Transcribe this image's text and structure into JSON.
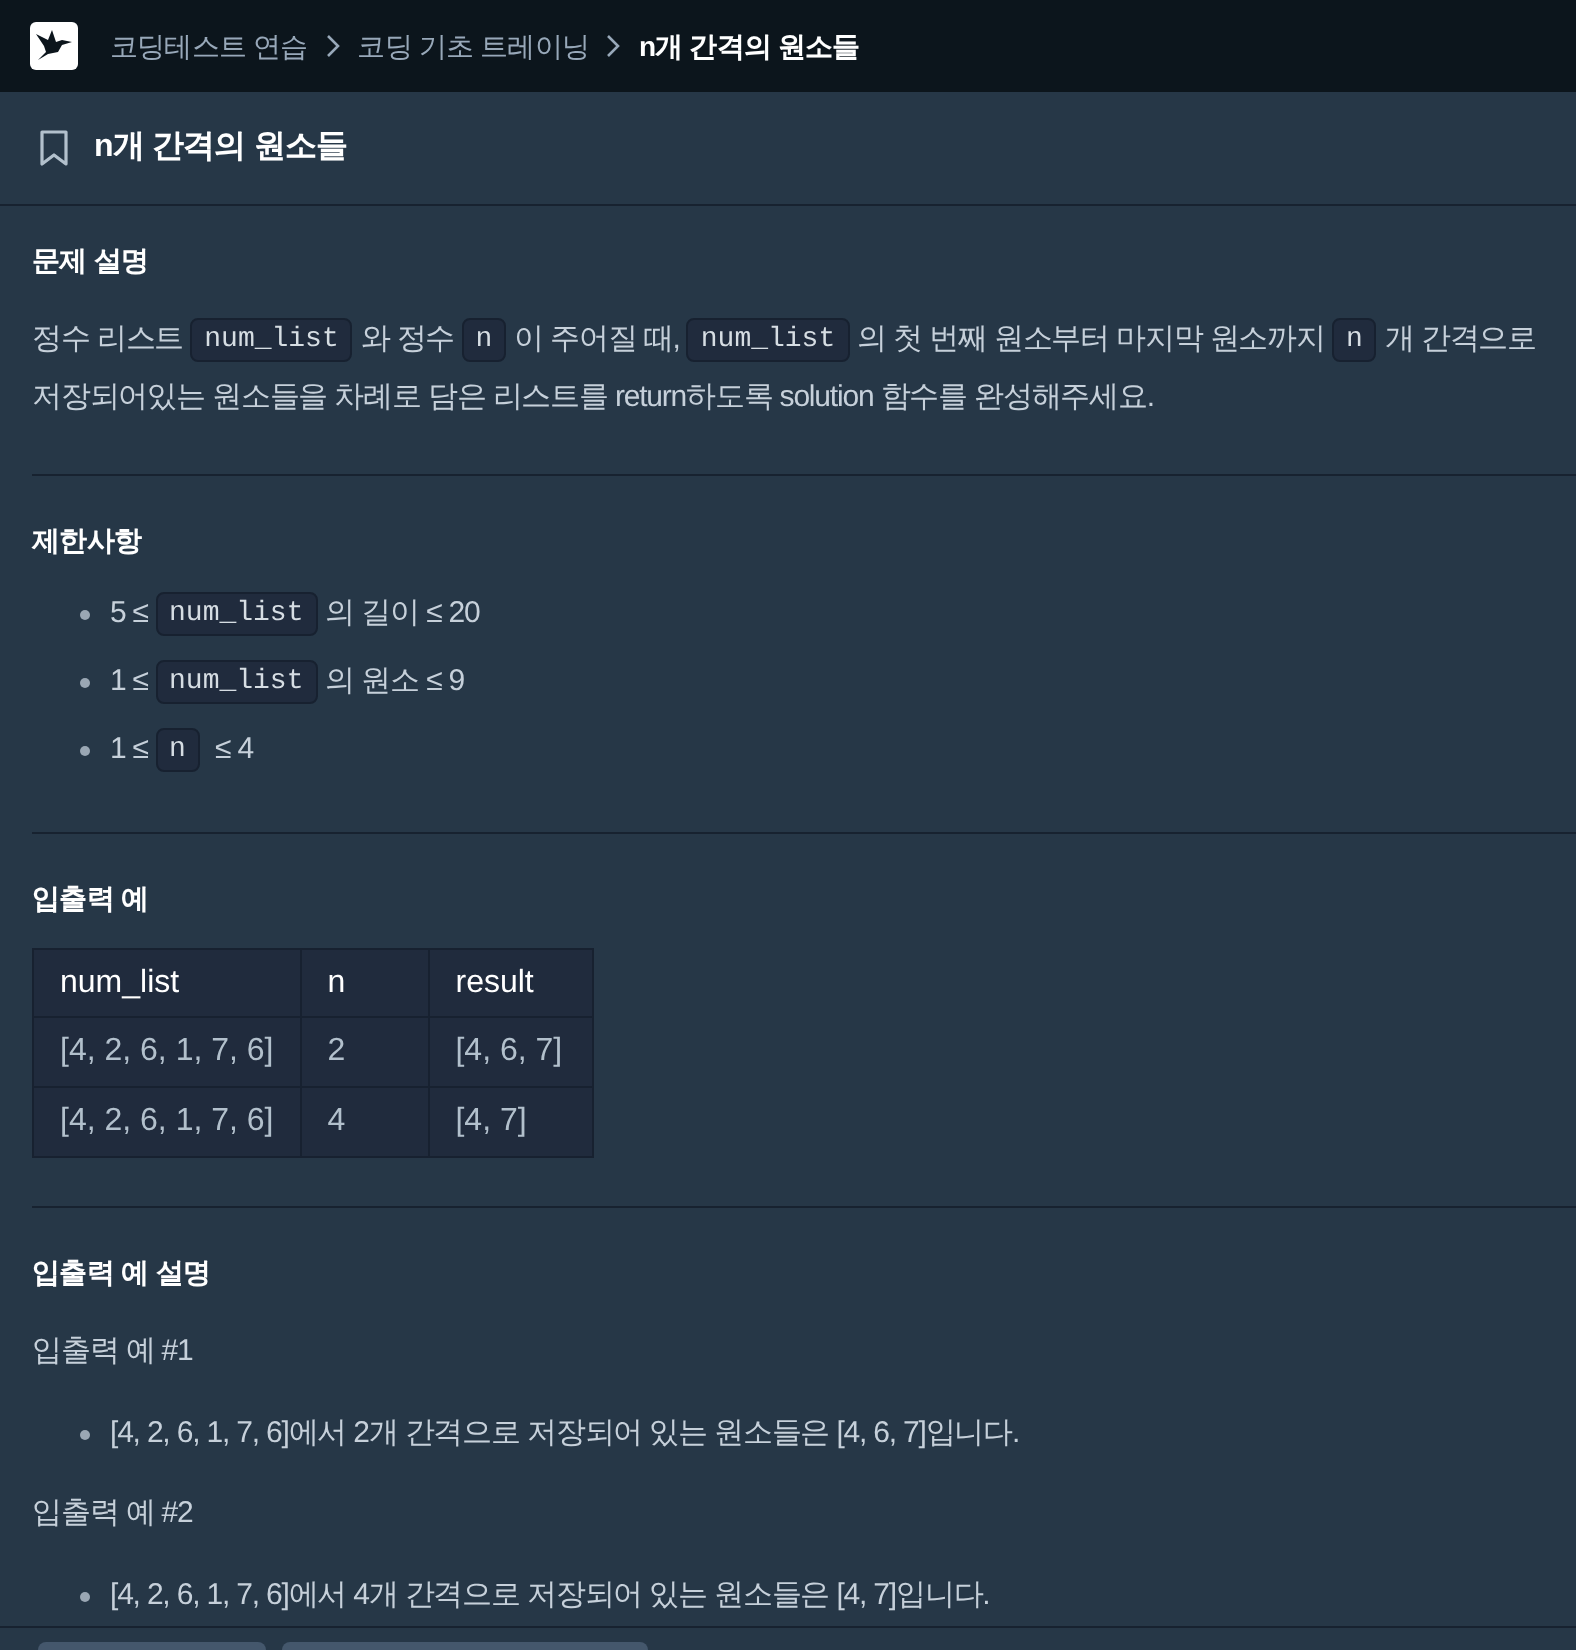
{
  "breadcrumb": [
    {
      "label": "코딩테스트 연습",
      "current": false
    },
    {
      "label": "코딩 기초 트레이닝",
      "current": false
    },
    {
      "label": "n개 간격의 원소들",
      "current": true
    }
  ],
  "title": "n개 간격의 원소들",
  "sections": [
    {
      "heading": "문제 설명",
      "blocks": [
        {
          "kind": "paragraph",
          "parts": [
            {
              "kind": "text",
              "text": "정수 리스트 "
            },
            {
              "kind": "code",
              "text": "num_list"
            },
            {
              "kind": "text",
              "text": "와 정수 "
            },
            {
              "kind": "code",
              "text": "n"
            },
            {
              "kind": "text",
              "text": "이 주어질 때, "
            },
            {
              "kind": "code",
              "text": "num_list"
            },
            {
              "kind": "text",
              "text": "의 첫 번째 원소부터 마지막 원소까지 "
            },
            {
              "kind": "code",
              "text": "n"
            },
            {
              "kind": "text",
              "text": "개 간격으로 저장되어있는 원소들을 차례로 담은 리스트를 return하도록 solution 함수를 완성해주세요."
            }
          ]
        }
      ]
    },
    {
      "heading": "제한사항",
      "blocks": [
        {
          "kind": "bullets",
          "items": [
            {
              "parts": [
                {
                  "kind": "text",
                  "text": "5 ≤ "
                },
                {
                  "kind": "code",
                  "text": "num_list"
                },
                {
                  "kind": "text",
                  "text": "의 길이 ≤ 20"
                }
              ]
            },
            {
              "parts": [
                {
                  "kind": "text",
                  "text": "1 ≤ "
                },
                {
                  "kind": "code",
                  "text": "num_list"
                },
                {
                  "kind": "text",
                  "text": "의 원소 ≤ 9"
                }
              ]
            },
            {
              "parts": [
                {
                  "kind": "text",
                  "text": "1 ≤ "
                },
                {
                  "kind": "code",
                  "text": "n"
                },
                {
                  "kind": "text",
                  "text": " ≤ 4"
                }
              ]
            }
          ]
        }
      ]
    },
    {
      "heading": "입출력 예",
      "blocks": [
        {
          "kind": "table",
          "columns": [
            "num_list",
            "n",
            "result"
          ],
          "rows": [
            [
              "[4, 2, 6, 1, 7, 6]",
              "2",
              "[4, 6, 7]"
            ],
            [
              "[4, 2, 6, 1, 7, 6]",
              "4",
              "[4, 7]"
            ]
          ]
        }
      ]
    },
    {
      "heading": "입출력 예 설명",
      "blocks": [
        {
          "kind": "paragraph",
          "parts": [
            {
              "kind": "text",
              "text": "입출력 예 #1"
            }
          ]
        },
        {
          "kind": "bullets",
          "items": [
            {
              "parts": [
                {
                  "kind": "text",
                  "text": "[4, 2, 6, 1, 7, 6]에서 2개 간격으로 저장되어 있는 원소들은 [4, 6, 7]입니다."
                }
              ]
            }
          ]
        },
        {
          "kind": "paragraph",
          "parts": [
            {
              "kind": "text",
              "text": "입출력 예 #2"
            }
          ]
        },
        {
          "kind": "bullets",
          "items": [
            {
              "parts": [
                {
                  "kind": "text",
                  "text": "[4, 2, 6, 1, 7, 6]에서 4개 간격으로 저장되어 있는 원소들은 [4, 7]입니다."
                }
              ]
            }
          ]
        }
      ]
    }
  ]
}
